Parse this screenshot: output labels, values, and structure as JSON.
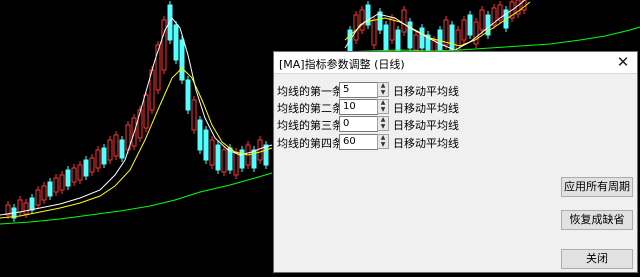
{
  "dialog": {
    "title": "[MA]指标参数调整 (日线)",
    "rows": [
      {
        "label": "均线的第一条",
        "value": "5",
        "unit": "日移动平均线"
      },
      {
        "label": "均线的第二条",
        "value": "10",
        "unit": "日移动平均线"
      },
      {
        "label": "均线的第三条",
        "value": "0",
        "unit": "日移动平均线"
      },
      {
        "label": "均线的第四条",
        "value": "60",
        "unit": "日移动平均线"
      }
    ],
    "buttons": {
      "apply_all": "应用所有周期",
      "restore_default": "恢复成缺省",
      "close": "关闭"
    }
  },
  "colors": {
    "background": "#000000",
    "up_candle": "#ff3232",
    "down_candle": "#54ffff",
    "ma5": "#ffffff",
    "ma10": "#ffff00",
    "ma60": "#00ff00"
  }
}
